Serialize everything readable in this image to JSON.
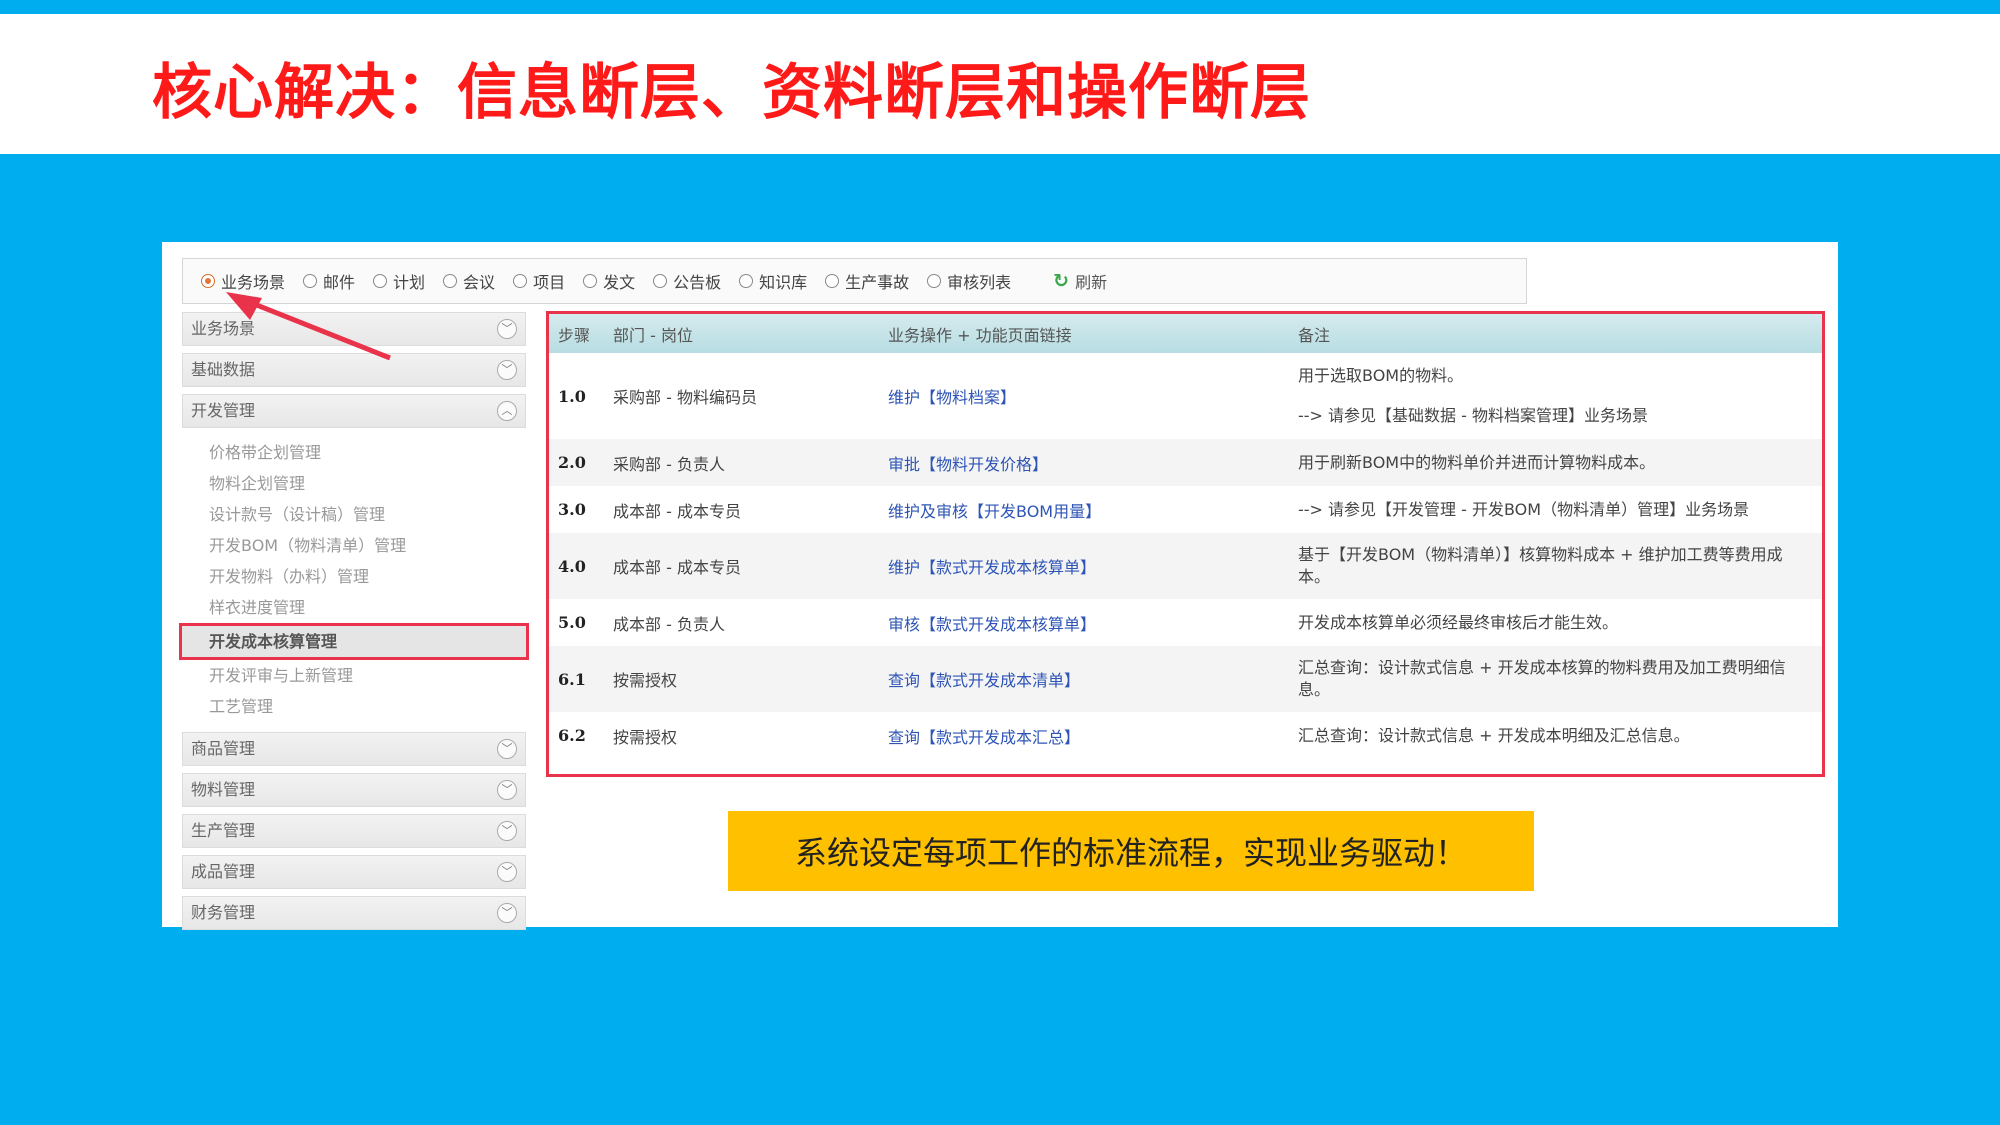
{
  "slide": {
    "title": "核心解决：信息断层、资料断层和操作断层"
  },
  "radio_bar": {
    "items": [
      {
        "label": "业务场景",
        "checked": true
      },
      {
        "label": "邮件",
        "checked": false
      },
      {
        "label": "计划",
        "checked": false
      },
      {
        "label": "会议",
        "checked": false
      },
      {
        "label": "项目",
        "checked": false
      },
      {
        "label": "发文",
        "checked": false
      },
      {
        "label": "公告板",
        "checked": false
      },
      {
        "label": "知识库",
        "checked": false
      },
      {
        "label": "生产事故",
        "checked": false
      },
      {
        "label": "审核列表",
        "checked": false
      }
    ],
    "refresh_label": "刷新",
    "refresh_icon": "refresh-icon"
  },
  "sidebar": {
    "groups_top": [
      "业务场景",
      "基础数据"
    ],
    "expanded_group": "开发管理",
    "sub_items": [
      {
        "label": "价格带企划管理",
        "active": false
      },
      {
        "label": "物料企划管理",
        "active": false
      },
      {
        "label": "设计款号（设计稿）管理",
        "active": false
      },
      {
        "label": "开发BOM（物料清单）管理",
        "active": false
      },
      {
        "label": "开发物料（办料）管理",
        "active": false
      },
      {
        "label": "样衣进度管理",
        "active": false
      },
      {
        "label": "开发成本核算管理",
        "active": true
      },
      {
        "label": "开发评审与上新管理",
        "active": false
      },
      {
        "label": "工艺管理",
        "active": false
      }
    ],
    "groups_bottom": [
      "商品管理",
      "物料管理",
      "生产管理",
      "成品管理",
      "财务管理"
    ]
  },
  "table": {
    "headers": [
      "步骤",
      "部门 - 岗位",
      "业务操作 + 功能页面链接",
      "备注"
    ],
    "rows": [
      {
        "step": "1.0",
        "dept": "采购部 - 物料编码员",
        "op": "维护【物料档案】",
        "note": [
          "用于选取BOM的物料。",
          "--> 请参见【基础数据 - 物料档案管理】业务场景"
        ]
      },
      {
        "step": "2.0",
        "dept": "采购部 - 负责人",
        "op": "审批【物料开发价格】",
        "note": [
          "用于刷新BOM中的物料单价并进而计算物料成本。"
        ]
      },
      {
        "step": "3.0",
        "dept": "成本部 - 成本专员",
        "op": "维护及审核【开发BOM用量】",
        "note": [
          "--> 请参见【开发管理 - 开发BOM（物料清单）管理】业务场景"
        ]
      },
      {
        "step": "4.0",
        "dept": "成本部 - 成本专员",
        "op": "维护【款式开发成本核算单】",
        "note": [
          "基于【开发BOM（物料清单）】核算物料成本 + 维护加工费等费用成本。"
        ]
      },
      {
        "step": "5.0",
        "dept": "成本部 - 负责人",
        "op": "审核【款式开发成本核算单】",
        "note": [
          "开发成本核算单必须经最终审核后才能生效。"
        ]
      },
      {
        "step": "6.1",
        "dept": "按需授权",
        "op": "查询【款式开发成本清单】",
        "note": [
          "汇总查询：设计款式信息 + 开发成本核算的物料费用及加工费明细信息。"
        ]
      },
      {
        "step": "6.2",
        "dept": "按需授权",
        "op": "查询【款式开发成本汇总】",
        "note": [
          "汇总查询：设计款式信息 + 开发成本明细及汇总信息。"
        ]
      }
    ]
  },
  "callout": {
    "text": "系统设定每项工作的标准流程，实现业务驱动！"
  },
  "colors": {
    "background": "#00aeef",
    "title": "#ff1a1a",
    "highlight_border": "#e8334a",
    "link": "#2e55b6",
    "callout": "#ffc000"
  }
}
